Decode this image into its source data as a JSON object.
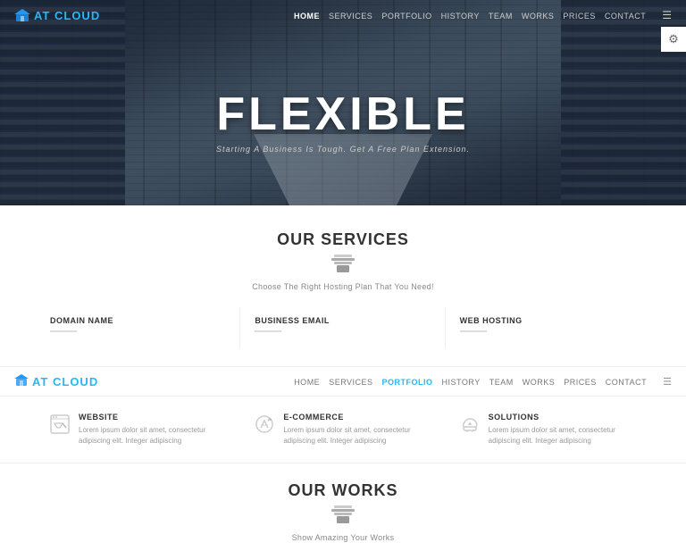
{
  "brand": {
    "name_prefix": "AT ",
    "name_highlight": "CLOUD",
    "logo_icon": "🏠"
  },
  "navbar": {
    "links": [
      {
        "label": "HOME",
        "active": true
      },
      {
        "label": "SERVICES",
        "active": false
      },
      {
        "label": "PORTFOLIO",
        "active": false
      },
      {
        "label": "HISTORY",
        "active": false
      },
      {
        "label": "TEAM",
        "active": false
      },
      {
        "label": "WORKS",
        "active": false
      },
      {
        "label": "PRICES",
        "active": false
      },
      {
        "label": "CONTACT",
        "active": false
      }
    ]
  },
  "hero": {
    "title": "FLEXIBLE",
    "subtitle": "Starting A Business Is Tough. Get A Free Plan Extension."
  },
  "services_section": {
    "title": "OUR SERVICES",
    "icon": "🔧",
    "description": "Choose The Right Hosting Plan That You Need!",
    "items_row1": [
      {
        "title": "DOMAIN NAME"
      },
      {
        "title": "BUSINESS EMAIL"
      },
      {
        "title": "WEB HOSTING"
      }
    ],
    "items_row2": [
      {
        "icon": "✏️",
        "title": "WEBSITE",
        "text": "Lorem ipsum dolor sit amet, consectetur adipiscing elit. Integer adipiscing"
      },
      {
        "icon": "↗️",
        "title": "E-COMMERCE",
        "text": "Lorem ipsum dolor sit amet, consectetur adipiscing elit. Integer adipiscing"
      },
      {
        "icon": "☁️",
        "title": "SOLUTIONS",
        "text": "Lorem ipsum dolor sit amet, consectetur adipiscing elit. Integer adipiscing"
      }
    ]
  },
  "navbar2": {
    "links": [
      {
        "label": "HOME",
        "active": false
      },
      {
        "label": "SERVICES",
        "active": false
      },
      {
        "label": "PORTFOLIO",
        "active": true
      },
      {
        "label": "HISTORY",
        "active": false
      },
      {
        "label": "TEAM",
        "active": false
      },
      {
        "label": "WORKS",
        "active": false
      },
      {
        "label": "PRICES",
        "active": false
      },
      {
        "label": "CONTACT",
        "active": false
      }
    ]
  },
  "works_section": {
    "title": "OUR WORKS",
    "icon": "🔧",
    "description": "Show Amazing Your Works"
  },
  "gear_icon": "⚙"
}
